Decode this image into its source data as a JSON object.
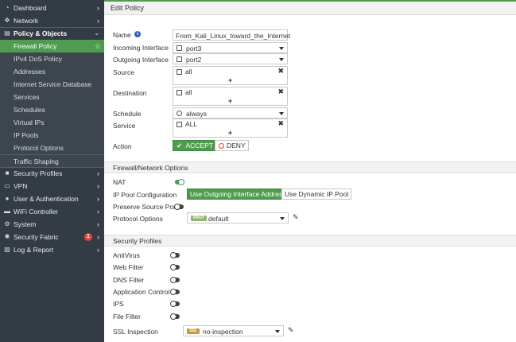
{
  "sidebar": {
    "items": [
      {
        "label": "Dashboard",
        "icon": "dashboard-icon",
        "glyph": "◔"
      },
      {
        "label": "Network",
        "icon": "network-icon",
        "glyph": "✥"
      },
      {
        "label": "Policy & Objects",
        "icon": "policy-icon",
        "glyph": "▤"
      },
      {
        "label": "Firewall Policy"
      },
      {
        "label": "IPv4 DoS Policy"
      },
      {
        "label": "Addresses"
      },
      {
        "label": "Internet Service Database"
      },
      {
        "label": "Services"
      },
      {
        "label": "Schedules"
      },
      {
        "label": "Virtual IPs"
      },
      {
        "label": "IP Pools"
      },
      {
        "label": "Protocol Options"
      },
      {
        "label": "Traffic Shaping"
      },
      {
        "label": "Security Profiles",
        "icon": "lock-icon",
        "glyph": "🔒"
      },
      {
        "label": "VPN",
        "icon": "vpn-icon",
        "glyph": "▭"
      },
      {
        "label": "User & Authentication",
        "icon": "user-icon",
        "glyph": "👤"
      },
      {
        "label": "WiFi Controller",
        "icon": "wifi-icon",
        "glyph": "▬"
      },
      {
        "label": "System",
        "icon": "gear-icon",
        "glyph": "⚙"
      },
      {
        "label": "Security Fabric",
        "icon": "fabric-icon",
        "glyph": "✺",
        "badge": "1"
      },
      {
        "label": "Log & Report",
        "icon": "chart-icon",
        "glyph": "▨"
      }
    ]
  },
  "header": {
    "title": "Edit Policy"
  },
  "form": {
    "name_label": "Name",
    "name_value": "From_Kali_Linux_toward_the_Internet",
    "incoming_label": "Incoming Interface",
    "incoming_value": "port3",
    "outgoing_label": "Outgoing Interface",
    "outgoing_value": "port2",
    "source_label": "Source",
    "source_value": "all",
    "destination_label": "Destination",
    "destination_value": "all",
    "schedule_label": "Schedule",
    "schedule_value": "always",
    "service_label": "Service",
    "service_value": "ALL",
    "action_label": "Action",
    "accept_label": "ACCEPT",
    "deny_label": "DENY",
    "plus": "+",
    "remove": "✖"
  },
  "firewall_network": {
    "section_title": "Firewall/Network Options",
    "nat_label": "NAT",
    "nat_on": true,
    "ip_pool_label": "IP Pool Configuration",
    "ip_pool_options": [
      "Use Outgoing Interface Address",
      "Use Dynamic IP Pool"
    ],
    "preserve_label": "Preserve Source Port",
    "preserve_on": false,
    "protocol_label": "Protocol Options",
    "protocol_tag": "PROT",
    "protocol_value": "default"
  },
  "security_profiles": {
    "section_title": "Security Profiles",
    "items": [
      {
        "label": "AntiVirus",
        "on": false
      },
      {
        "label": "Web Filter",
        "on": false
      },
      {
        "label": "DNS Filter",
        "on": false
      },
      {
        "label": "Application Control",
        "on": false
      },
      {
        "label": "IPS",
        "on": false
      },
      {
        "label": "File Filter",
        "on": false
      }
    ],
    "ssl_label": "SSL Inspection",
    "ssl_tag": "SSL",
    "ssl_value": "no-inspection"
  },
  "colors": {
    "accent": "#4f9c4f",
    "sidebar_bg": "#333c44",
    "badge": "#e0483e",
    "prot_tag": "#8fb66c",
    "ssl_tag": "#c49a3a"
  }
}
